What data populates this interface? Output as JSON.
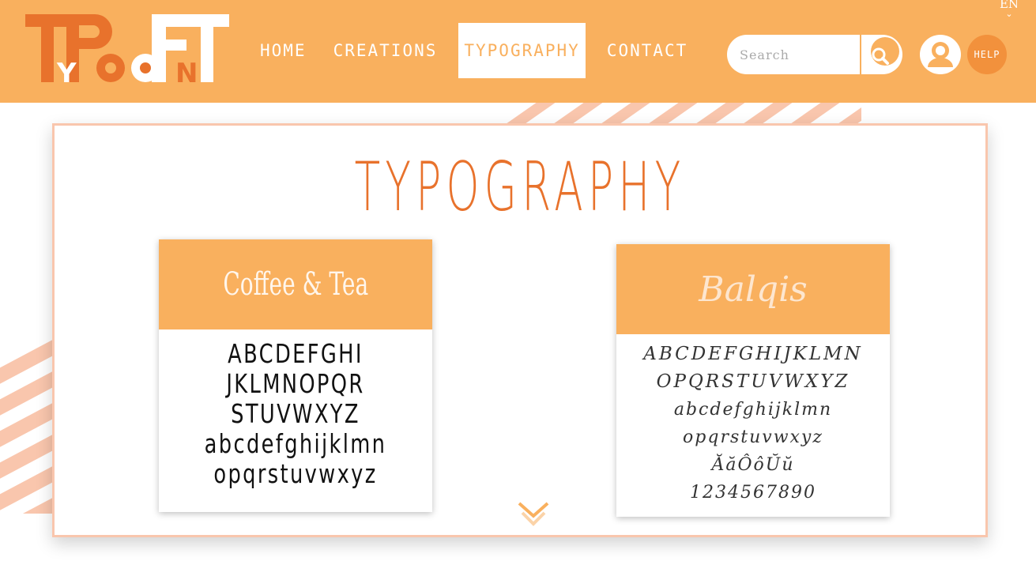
{
  "brand": {
    "logo_text": "TYPOFONT",
    "logo_letters": [
      "T",
      "P",
      "F",
      "T",
      "Y",
      "O",
      "N"
    ]
  },
  "colors": {
    "primary": "#f9b05e",
    "accent": "#e8722c",
    "stripe": "#f9c6ad",
    "help": "#f2913c"
  },
  "nav": {
    "items": [
      {
        "label": "HOME"
      },
      {
        "label": "CREATIONS"
      },
      {
        "label": "TYPOGRAPHY"
      },
      {
        "label": "CONTACT"
      }
    ]
  },
  "search": {
    "placeholder": "Search",
    "icon": "magnifier-icon"
  },
  "user": {
    "icon": "user-icon"
  },
  "help": {
    "label": "HELP"
  },
  "language": {
    "label": "EN",
    "icon": "chevron-down-icon"
  },
  "main": {
    "title": "TYPOGRAPHY",
    "fonts": [
      {
        "name": "Coffee & Tea",
        "sample_lines": [
          "ABCDEFGHI",
          "JKLMNOPQR",
          "STUVWXYZ",
          "abcdefghijklmn",
          "opqrstuvwxyz"
        ]
      },
      {
        "name": "Balqis",
        "sample_lines": [
          "ABCDEFGHIJKLMN",
          "OPQRSTUVWXYZ",
          "abcdefghijklmn",
          "opqrstuvwxyz",
          "ĂăÔôŬŭ",
          "1234567890"
        ]
      }
    ],
    "scroll_icon": "double-chevron-down-icon"
  }
}
